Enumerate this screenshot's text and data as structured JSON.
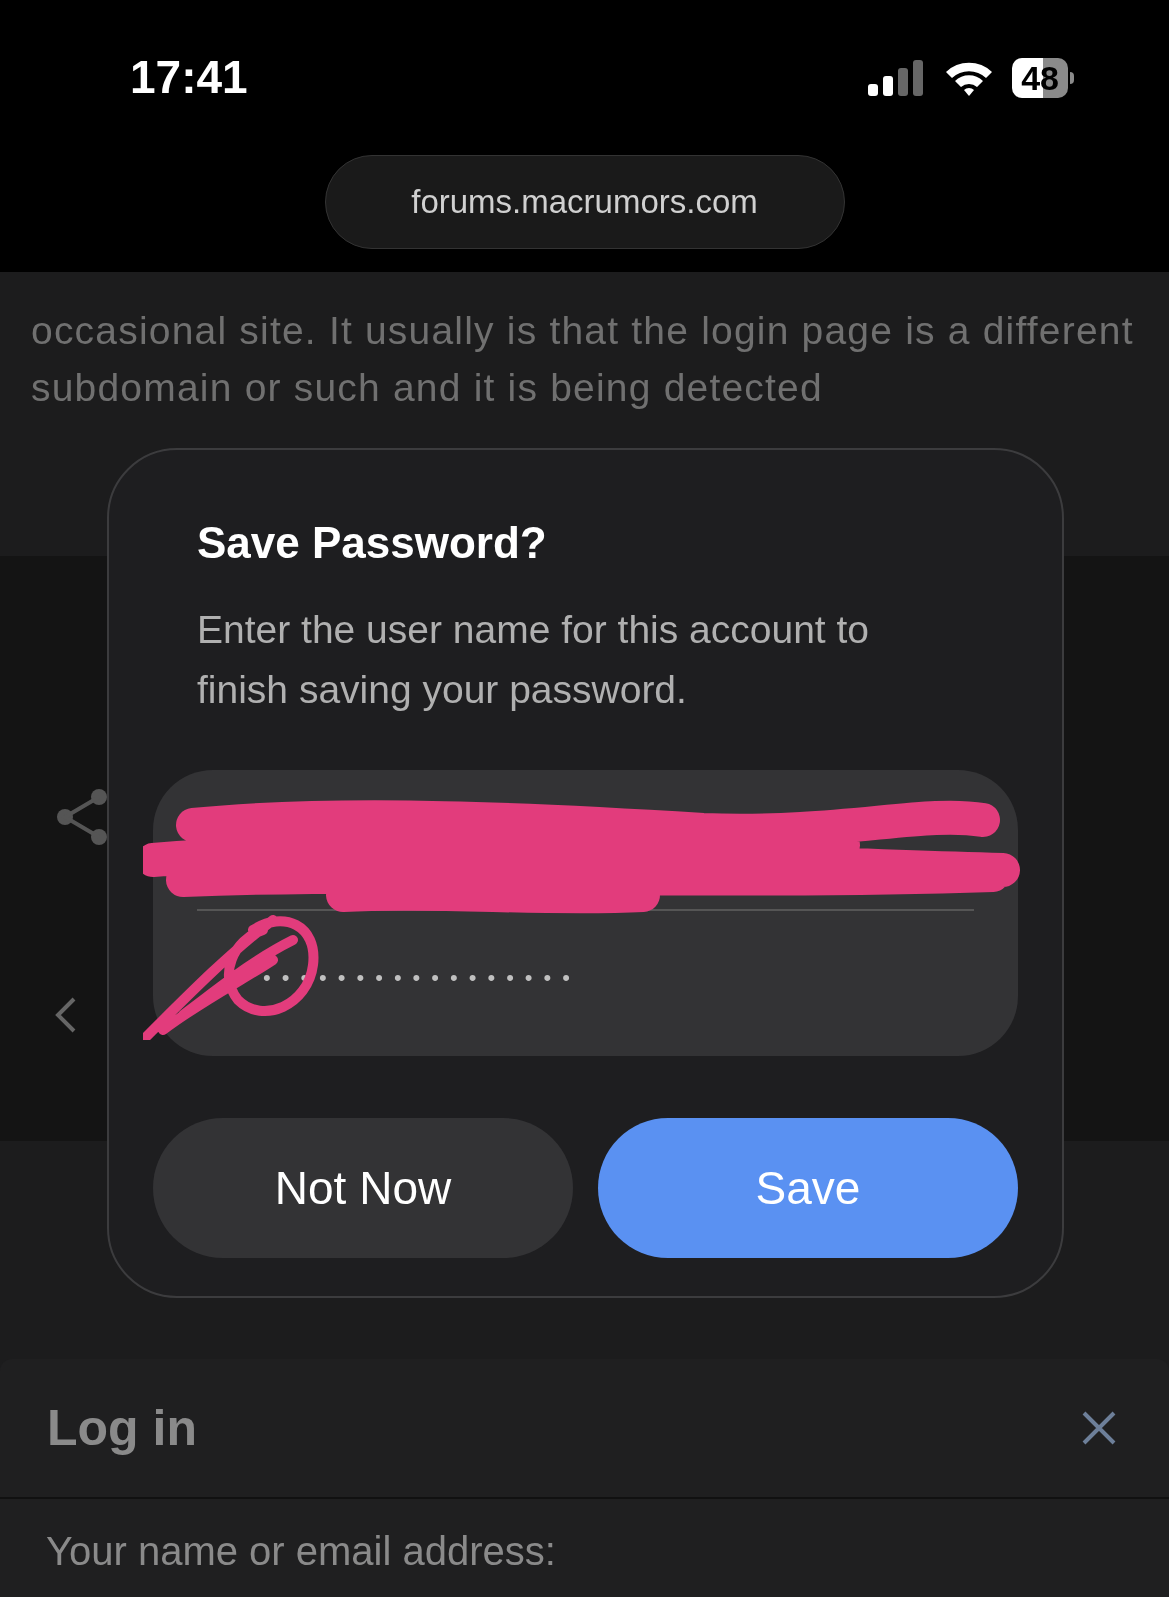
{
  "status_bar": {
    "time": "17:41",
    "battery": "48"
  },
  "address_bar": {
    "url": "forums.macrumors.com"
  },
  "article": {
    "text": "occasional site. It usually is that the login page is a different subdomain or such and it is being detected"
  },
  "dialog": {
    "title": "Save Password?",
    "message": "Enter the user name for this account to finish saving your password.",
    "password_field": {
      "value": "•••••••••••••••••"
    },
    "buttons": [
      {
        "label": "Not Now",
        "kind": "secondary"
      },
      {
        "label": "Save",
        "kind": "primary"
      }
    ]
  },
  "login_sheet": {
    "title": "Log in",
    "field_label": "Your name or email address:"
  }
}
